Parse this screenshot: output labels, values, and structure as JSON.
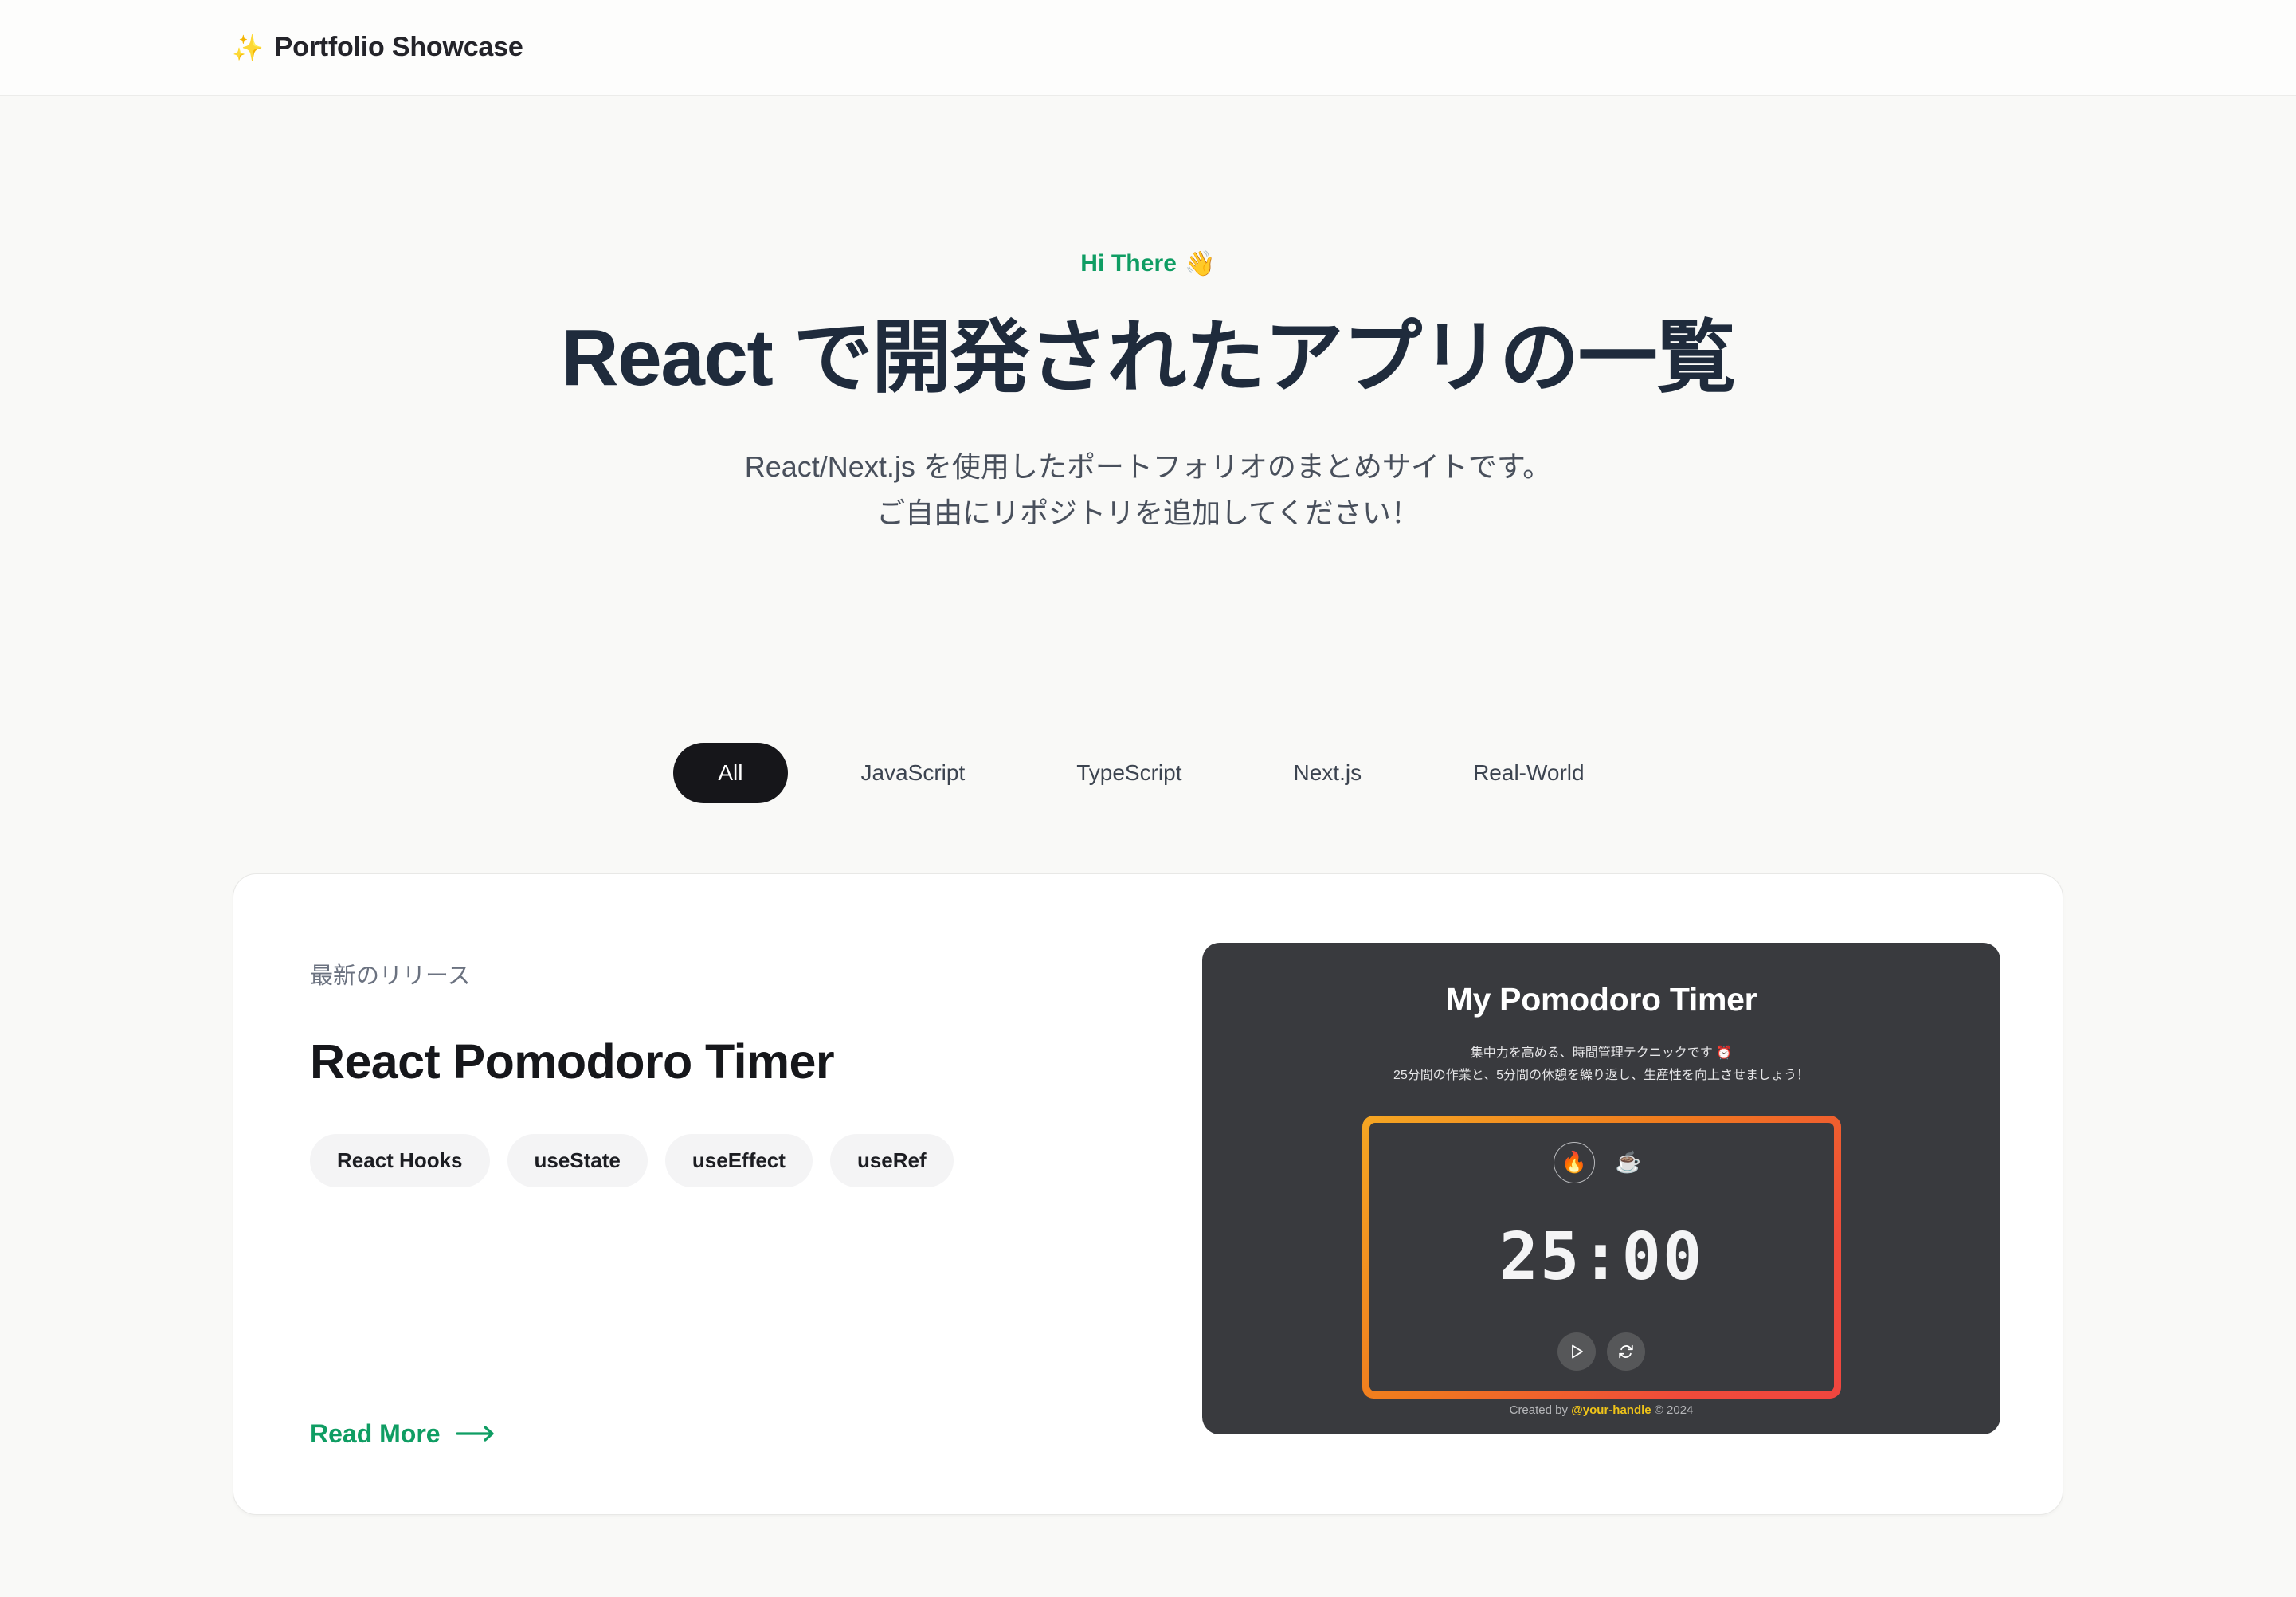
{
  "header": {
    "brand_icon": "sparkles-icon",
    "brand_sparkle": "✨",
    "brand_name": "Portfolio Showcase"
  },
  "hero": {
    "eyebrow": "Hi There",
    "eyebrow_emoji": "👋",
    "eyebrow_color": "#0f9d63",
    "title": "React で開発されたアプリの一覧",
    "subtitle_line1": "React/Next.js を使用したポートフォリオのまとめサイトです。",
    "subtitle_line2": "ご自由にリポジトリを追加してください！"
  },
  "filters": {
    "active_index": 0,
    "tabs": [
      {
        "label": "All"
      },
      {
        "label": "JavaScript"
      },
      {
        "label": "TypeScript"
      },
      {
        "label": "Next.js"
      },
      {
        "label": "Real-World"
      }
    ]
  },
  "project_card": {
    "release_label": "最新のリリース",
    "title": "React Pomodoro Timer",
    "tags": [
      {
        "label": "React Hooks"
      },
      {
        "label": "useState"
      },
      {
        "label": "useEffect"
      },
      {
        "label": "useRef"
      }
    ],
    "read_more_label": "Read More",
    "read_more_color": "#0f9d63",
    "preview": {
      "title": "My Pomodoro Timer",
      "desc_line1": "集中力を高める、時間管理テクニックです",
      "desc_line1_emoji": "⏰",
      "desc_line2": "25分間の作業と、5分間の休憩を繰り返し、生産性を向上させましょう！",
      "modes": [
        {
          "emoji": "🔥",
          "name": "focus-mode",
          "selected": true
        },
        {
          "emoji": "☕",
          "name": "break-mode",
          "selected": false
        }
      ],
      "time_display": "25:00",
      "controls": [
        {
          "name": "play-button",
          "icon": "play-icon"
        },
        {
          "name": "reset-button",
          "icon": "reset-icon"
        }
      ],
      "footer_prefix": "Created by ",
      "footer_handle": "@your-handle",
      "footer_suffix": " © 2024",
      "frame_gradient_from": "#f5a623",
      "frame_gradient_to": "#f0463f",
      "background": "#393a3e"
    }
  }
}
